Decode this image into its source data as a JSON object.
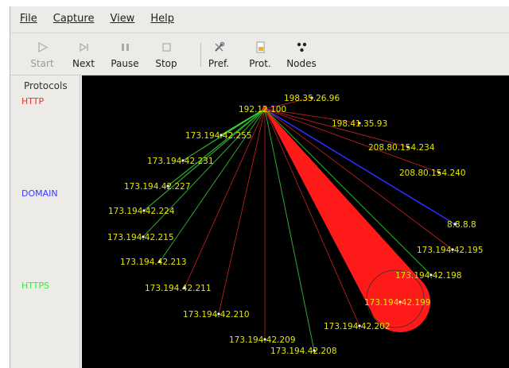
{
  "menu": [
    "File",
    "Capture",
    "View",
    "Help"
  ],
  "toolbar": {
    "start": "Start",
    "next": "Next",
    "pause": "Pause",
    "stop": "Stop",
    "pref": "Pref.",
    "prot": "Prot.",
    "nodes": "Nodes"
  },
  "sidebar": {
    "title": "Protocols",
    "protocols": [
      {
        "name": "HTTP",
        "color": "#ff2a2a"
      },
      {
        "name": "DOMAIN",
        "color": "#3a3aff"
      },
      {
        "name": "HTTPS",
        "color": "#33ee33"
      }
    ]
  },
  "graph": {
    "center": "192.12.100",
    "nodes": [
      {
        "label": "198.35.26.96"
      },
      {
        "label": "198.41.35.93"
      },
      {
        "label": "208.80.154.234"
      },
      {
        "label": "208.80.154.240"
      },
      {
        "label": "8.8.8.8"
      },
      {
        "label": "173.194.42.195"
      },
      {
        "label": "173.194.42.198"
      },
      {
        "label": "173.194.42.199"
      },
      {
        "label": "173.194.42.202"
      },
      {
        "label": "173.194.42.208"
      },
      {
        "label": "173.194.42.209"
      },
      {
        "label": "173.194.42.210"
      },
      {
        "label": "173.194.42.211"
      },
      {
        "label": "173.194.42.213"
      },
      {
        "label": "173.194.42.215"
      },
      {
        "label": "173.194.42.224"
      },
      {
        "label": "173.194.42.227"
      },
      {
        "label": "173.194.42.231"
      },
      {
        "label": "173.194.42.255"
      }
    ]
  }
}
